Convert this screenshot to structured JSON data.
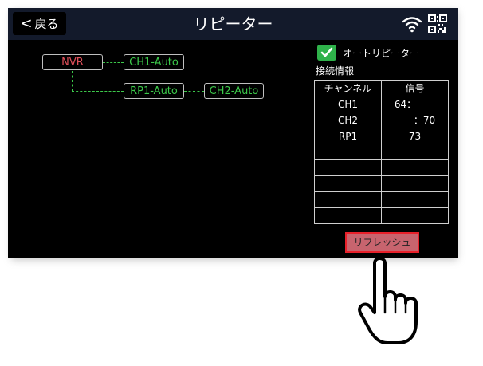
{
  "header": {
    "back_label": "戻る",
    "title": "リピーター",
    "icons": [
      "wifi-icon",
      "qr-code-icon"
    ]
  },
  "topology": {
    "root": "NVR",
    "nodes": [
      "CH1-Auto",
      "RP1-Auto",
      "CH2-Auto"
    ]
  },
  "auto_repeater": {
    "label": "オートリピーター",
    "checked": true
  },
  "connection_info": {
    "title": "接続情報",
    "columns": [
      "チャンネル",
      "信号"
    ],
    "rows": [
      [
        "CH1",
        "64：－－"
      ],
      [
        "CH2",
        "－－：70"
      ],
      [
        "RP1",
        "73"
      ],
      [
        "",
        ""
      ],
      [
        "",
        ""
      ],
      [
        "",
        ""
      ],
      [
        "",
        ""
      ],
      [
        "",
        ""
      ]
    ]
  },
  "refresh_label": "リフレッシュ",
  "colors": {
    "accent_green": "#3cc94a",
    "nvr_red": "#e0505a",
    "highlight_red": "#e8202a",
    "header_bg": "#131a2b"
  }
}
